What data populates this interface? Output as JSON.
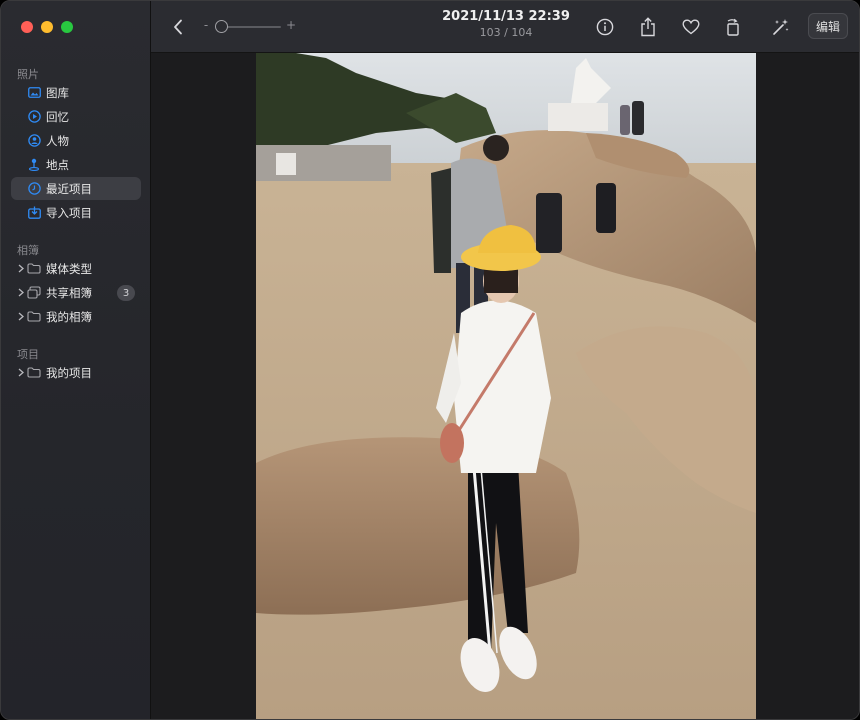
{
  "window": {
    "app": "Photos"
  },
  "sidebar": {
    "sections": [
      {
        "title": "照片"
      },
      {
        "title": "相簿"
      },
      {
        "title": "项目"
      }
    ],
    "photos_items": [
      {
        "label": "图库",
        "icon": "library-icon"
      },
      {
        "label": "回忆",
        "icon": "memories-icon"
      },
      {
        "label": "人物",
        "icon": "people-icon"
      },
      {
        "label": "地点",
        "icon": "places-icon"
      },
      {
        "label": "最近项目",
        "icon": "recents-icon",
        "selected": true
      },
      {
        "label": "导入项目",
        "icon": "imports-icon"
      }
    ],
    "album_items": [
      {
        "label": "媒体类型",
        "icon": "folder-icon"
      },
      {
        "label": "共享相簿",
        "icon": "shared-albums-icon",
        "badge": "3"
      },
      {
        "label": "我的相簿",
        "icon": "folder-icon"
      }
    ],
    "project_items": [
      {
        "label": "我的项目",
        "icon": "folder-icon"
      }
    ]
  },
  "toolbar": {
    "zoom_minus": "-",
    "zoom_plus": "+",
    "zoom_level": 0,
    "date": "2021/11/13 22:39",
    "position": "103 / 104",
    "edit_label": "编辑"
  },
  "colors": {
    "accent": "#2f8bf5",
    "sidebar_bg": "#26272c",
    "toolbar_bg": "#2b2c31"
  }
}
